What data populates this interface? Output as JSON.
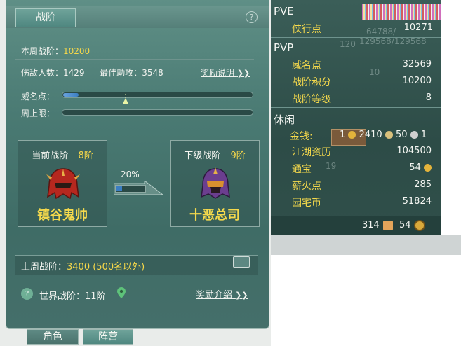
{
  "left": {
    "tab_active": "战阶",
    "help": "?",
    "this_week_label": "本周战阶：",
    "this_week_value": "10200",
    "kills_label": "伤敌人数：",
    "kills_value": "1429",
    "assist_label": "最佳助攻：",
    "assist_value": "3548",
    "reward_desc": "奖励说明",
    "reward_arrow": "❯❯",
    "prestige_label": "威名点：",
    "prestige_progress": 0.08,
    "weekly_cap_label": "周上限：",
    "weekly_cap_progress": 0,
    "current_title": "当前战阶",
    "current_level": "8阶",
    "current_name": "镇谷鬼帅",
    "next_title": "下级战阶",
    "next_level": "9阶",
    "next_name": "十恶总司",
    "progress_pct": "20%",
    "progress_value": 0.2,
    "last_week_label": "上周战阶：",
    "last_week_value": "3400 (500名以外)",
    "world_label": "世界战阶：",
    "world_value": "11阶",
    "reward_intro": "奖励介绍",
    "bottom_tab_1": "角色",
    "bottom_tab_2": "阵营"
  },
  "right": {
    "pve": "PVE",
    "xiaxing_label": "侠行点",
    "xiaxing_value": "10271",
    "ghost_1": "64788/",
    "ghost_2": "129568/129568",
    "ghost_3": "120",
    "pvp": "PVP",
    "weiming_label": "威名点",
    "weiming_value": "32569",
    "ghost_4": "10",
    "zhanjie_points_label": "战阶积分",
    "zhanjie_points_value": "10200",
    "zhanjie_level_label": "战阶等级",
    "zhanjie_level_value": "8",
    "leisure": "休闲",
    "money_label": "金钱:",
    "money_1": "1",
    "money_2": "2410",
    "money_3": "50",
    "money_4": "1",
    "jianghu_label": "江湖资历",
    "jianghu_value": "104500",
    "tongbao_label": "通宝",
    "tongbao_ghost": "19",
    "tongbao_value": "54",
    "xinhuo_label": "薪火点",
    "xinhuo_value": "285",
    "yuanzhai_label": "园宅币",
    "yuanzhai_value": "51824",
    "footer_1": "314",
    "footer_2": "54",
    "colors": {
      "accent": "#f5d94c",
      "bar": "#3b7ec2"
    }
  }
}
